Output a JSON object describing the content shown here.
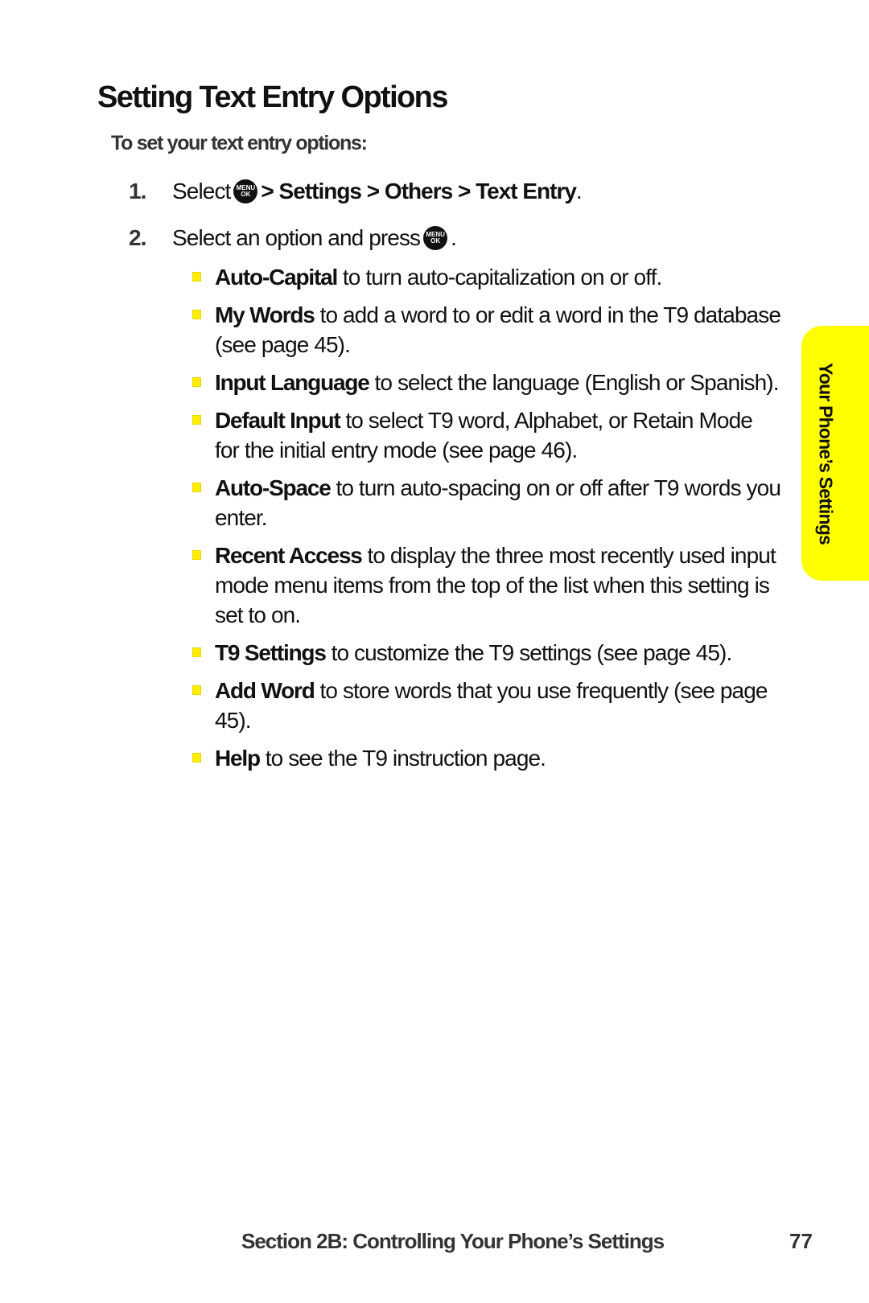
{
  "title": "Setting Text Entry Options",
  "subheading": "To set your text entry options:",
  "steps": [
    {
      "number": "1.",
      "prefix": "Select",
      "icon": {
        "name": "menu-ok-key-icon",
        "line1": "MENU",
        "line2": "OK"
      },
      "path": "> Settings > Others > Text Entry",
      "suffix": "."
    },
    {
      "number": "2.",
      "prefix": "Select an option and press",
      "icon": {
        "name": "menu-ok-key-icon",
        "line1": "MENU",
        "line2": "OK"
      },
      "suffix": "."
    }
  ],
  "options": [
    {
      "term": "Auto-Capital",
      "desc": " to turn auto-capitalization on or off."
    },
    {
      "term": "My Words",
      "desc": " to add a word to or edit a word in the T9 database (see page 45)."
    },
    {
      "term": "Input Language",
      "desc": " to select the language (English or Spanish)."
    },
    {
      "term": "Default Input",
      "desc": " to select T9 word, Alphabet, or Retain Mode for the initial entry mode (see page 46)."
    },
    {
      "term": "Auto-Space",
      "desc": " to turn auto-spacing on or off after T9 words you enter."
    },
    {
      "term": "Recent Access",
      "desc": " to display the three most recently used input mode menu items from the top of the list when this setting is set to on."
    },
    {
      "term": "T9 Settings",
      "desc": " to customize the T9 settings (see page 45)."
    },
    {
      "term": "Add Word",
      "desc": " to store words that you use frequently (see page 45)."
    },
    {
      "term": "Help",
      "desc": " to see the T9 instruction page."
    }
  ],
  "side_tab": {
    "label": "Your Phone’s Settings",
    "color": "#ffff00"
  },
  "footer": {
    "section": "Section 2B: Controlling Your Phone’s Settings",
    "page_number": "77"
  },
  "colors": {
    "bullet": "#ffee00",
    "text": "#111111",
    "subtext": "#333333"
  }
}
